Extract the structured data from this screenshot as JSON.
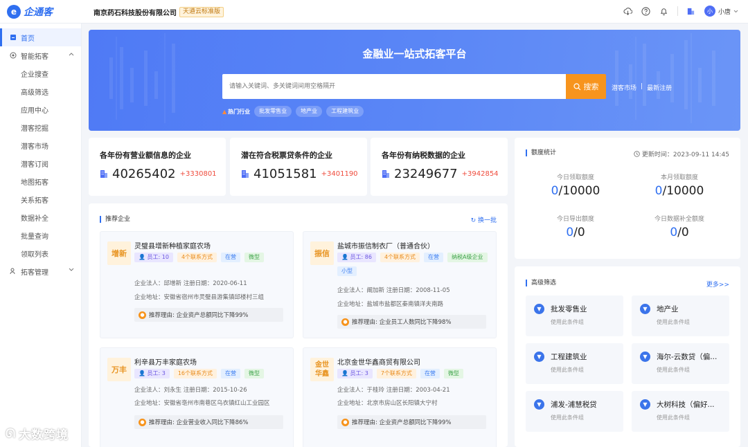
{
  "header": {
    "logo_text": "企通客",
    "company_name": "南京药石科技股份有限公司",
    "company_tag": "天遒云标准版",
    "user_avatar": "小",
    "user_name": "小唐"
  },
  "sidebar": {
    "items": [
      {
        "label": "首页",
        "icon": "home-icon",
        "active": true,
        "type": "top"
      },
      {
        "label": "智能拓客",
        "icon": "target-icon",
        "type": "top",
        "expanded": true
      },
      {
        "label": "企业搜查",
        "type": "sub"
      },
      {
        "label": "高级筛选",
        "type": "sub"
      },
      {
        "label": "应用中心",
        "type": "sub"
      },
      {
        "label": "潜客挖掘",
        "type": "sub"
      },
      {
        "label": "潜客市场",
        "type": "sub"
      },
      {
        "label": "潜客订阅",
        "type": "sub"
      },
      {
        "label": "地图拓客",
        "type": "sub"
      },
      {
        "label": "关系拓客",
        "type": "sub"
      },
      {
        "label": "数据补全",
        "type": "sub"
      },
      {
        "label": "批量查询",
        "type": "sub"
      },
      {
        "label": "领取列表",
        "type": "sub"
      },
      {
        "label": "拓客管理",
        "icon": "users-icon",
        "type": "top",
        "expanded": false
      }
    ]
  },
  "hero": {
    "title": "金融业一站式拓客平台",
    "search_placeholder": "请输入关键词、多关键词间用空格隔开",
    "search_button": "搜索",
    "link_market": "潜客市场",
    "link_sep": "|",
    "link_new": "最新注册",
    "hot_label": "热门行业",
    "hot_tags": [
      "批发零售业",
      "地产业",
      "工程建筑业"
    ]
  },
  "stats": [
    {
      "title": "各年份有营业额信息的企业",
      "value": "40265402",
      "delta": "+3330801"
    },
    {
      "title": "潜在符合税票贷条件的企业",
      "value": "41051581",
      "delta": "+3401190"
    },
    {
      "title": "各年份有纳税数据的企业",
      "value": "23249677",
      "delta": "+3942854"
    }
  ],
  "quota": {
    "title": "额度统计",
    "update_time": "更新时间：2023-09-11 14:45",
    "cells": [
      {
        "label": "今日领取额度",
        "used": "0",
        "total": "/10000"
      },
      {
        "label": "本月领取额度",
        "used": "0",
        "total": "/10000"
      },
      {
        "label": "今日导出额度",
        "used": "0",
        "total": "/0"
      },
      {
        "label": "今日数据补全额度",
        "used": "0",
        "total": "/0"
      }
    ]
  },
  "recommend": {
    "title": "推荐企业",
    "refresh": "换一批",
    "companies": [
      {
        "logo": "增新",
        "name": "灵璧县增新种植家庭农场",
        "tags": [
          {
            "text": "员工: 10",
            "kind": "staff"
          },
          {
            "text": "4个联系方式",
            "kind": "contact"
          },
          {
            "text": "在营",
            "kind": "status"
          },
          {
            "text": "微型",
            "kind": "size"
          }
        ],
        "legal": "企业法人：邱增新  注册日期：2020-06-11",
        "address": "企业地址：安徽省宿州市灵璧县游集镇邱楼村三组",
        "reason": "推荐理由:    企业资产总额同比下降99%"
      },
      {
        "logo": "振信",
        "name": "盐城市振信制衣厂（普通合伙）",
        "tags": [
          {
            "text": "员工: 86",
            "kind": "staff"
          },
          {
            "text": "4个联系方式",
            "kind": "contact"
          },
          {
            "text": "在营",
            "kind": "status"
          },
          {
            "text": "纳税A级企业",
            "kind": "cert"
          },
          {
            "text": "小型",
            "kind": "status"
          }
        ],
        "legal": "企业法人：阚加新  注册日期：2008-11-05",
        "address": "企业地址：盐城市盐都区秦南镇洋夫南路",
        "reason": "推荐理由:    企业员工人数同比下降98%"
      },
      {
        "logo": "万丰",
        "name": "利辛县万丰家庭农场",
        "tags": [
          {
            "text": "员工: 3",
            "kind": "staff"
          },
          {
            "text": "16个联系方式",
            "kind": "contact"
          },
          {
            "text": "在营",
            "kind": "status"
          },
          {
            "text": "微型",
            "kind": "size"
          }
        ],
        "legal": "企业法人：刘永生  注册日期：2015-10-26",
        "address": "企业地址：安徽省亳州市南巷区乌衣镇红山工业园区",
        "reason": "推荐理由:    企业营业收入同比下降86%"
      },
      {
        "logo": "金世华鑫",
        "name": "北京金世华鑫商贸有限公司",
        "tags": [
          {
            "text": "员工: 3",
            "kind": "staff"
          },
          {
            "text": "7个联系方式",
            "kind": "contact"
          },
          {
            "text": "在营",
            "kind": "status"
          },
          {
            "text": "微型",
            "kind": "size"
          }
        ],
        "legal": "企业法人：于桂玲  注册日期：2003-04-21",
        "address": "企业地址：北京市房山区长阳镇大宁村",
        "reason": "推荐理由:    企业资产总额同比下降99%"
      }
    ]
  },
  "advanced": {
    "title": "高级筛选",
    "more": "更多>>",
    "filters": [
      {
        "name": "批发零售业",
        "use": "使用此条件组"
      },
      {
        "name": "地产业",
        "use": "使用此条件组"
      },
      {
        "name": "工程建筑业",
        "use": "使用此条件组"
      },
      {
        "name": "海尔-云数贷（偏...",
        "use": "使用此条件组"
      },
      {
        "name": "浦发-浦慧税贷",
        "use": "使用此条件组"
      },
      {
        "name": "大树科技（偏好...",
        "use": "使用此条件组"
      }
    ]
  },
  "watermark": "大数跨境",
  "colors": {
    "primary": "#2f6ff0",
    "accent_orange": "#f7941d",
    "delta_red": "#ef4b3c",
    "hero_blue": "#5a86f6"
  }
}
